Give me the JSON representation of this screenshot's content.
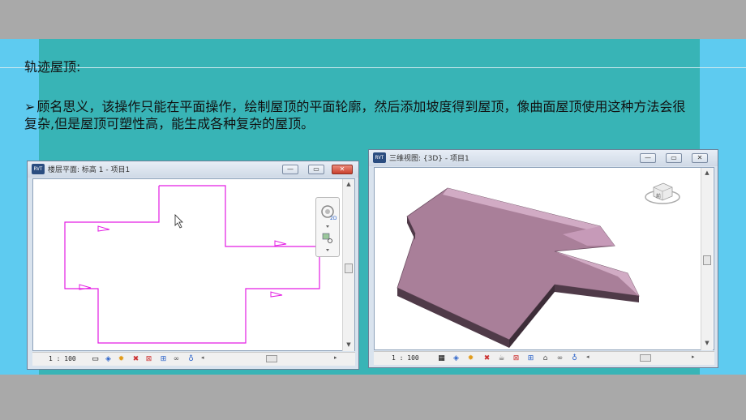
{
  "slide": {
    "title": "轨迹屋顶:",
    "bullet_symbol": "➢",
    "paragraph": "顾名思义，该操作只能在平面操作，绘制屋顶的平面轮廓，然后添加坡度得到屋顶，像曲面屋顶使用这种方法会很复杂,但是屋顶可塑性高，能生成各种复杂的屋顶。"
  },
  "plan_window": {
    "app_logo": "RVT",
    "title": "楼层平面: 标高 1 - 项目1",
    "scale": "1 : 100",
    "minimize_label": "—",
    "restore_label": "▭",
    "close_label": "✕",
    "sketch_color": "#e31ce3"
  },
  "view3d_window": {
    "app_logo": "RVT",
    "title": "三维视图: {3D} - 项目1",
    "scale": "1 : 100",
    "minimize_label": "—",
    "restore_label": "▭",
    "close_label": "✕",
    "viewcube_label": "前",
    "roof_color": "#a97f99"
  },
  "icons": {
    "view_control_plan": [
      "model-graphics-icon",
      "visual-style-icon",
      "sun-path-icon",
      "shadows-icon",
      "crop-region-icon",
      "show-crop-icon",
      "temporary-hide-icon",
      "reveal-hidden-icon"
    ],
    "view_control_3d": [
      "model-graphics-icon",
      "visual-style-icon",
      "sun-path-icon",
      "shadows-icon",
      "rendering-icon",
      "crop-region-icon",
      "show-crop-icon",
      "lock-3d-view-icon",
      "temporary-hide-icon",
      "reveal-hidden-icon"
    ]
  }
}
